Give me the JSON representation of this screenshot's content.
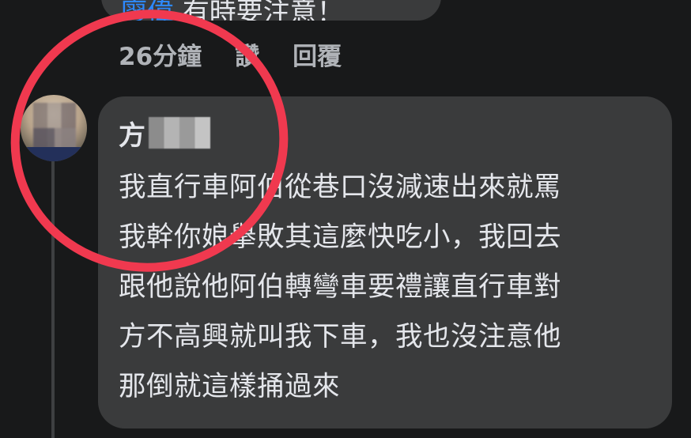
{
  "previous_comment": {
    "link_text": "廖偉",
    "text": "有時要注意！"
  },
  "actions": {
    "timestamp": "26分鐘",
    "like_label": "讚",
    "reply_label": "回覆"
  },
  "comment": {
    "author_visible": "方",
    "lines": [
      "我直行車阿伯從巷口沒減速出來就罵",
      "我幹你娘擧敗其這麼快吃小，我回去",
      "跟他說他阿伯轉彎車要禮讓直行車對",
      "方不高興就叫我下車，我也沒注意他",
      "那倒就這樣捅過來"
    ]
  },
  "colors": {
    "background": "#18191a",
    "bubble": "#3a3b3c",
    "text_primary": "#e4e6eb",
    "text_secondary": "#b0b3b8",
    "link": "#2d88ff",
    "annotation": "#f0394f"
  }
}
